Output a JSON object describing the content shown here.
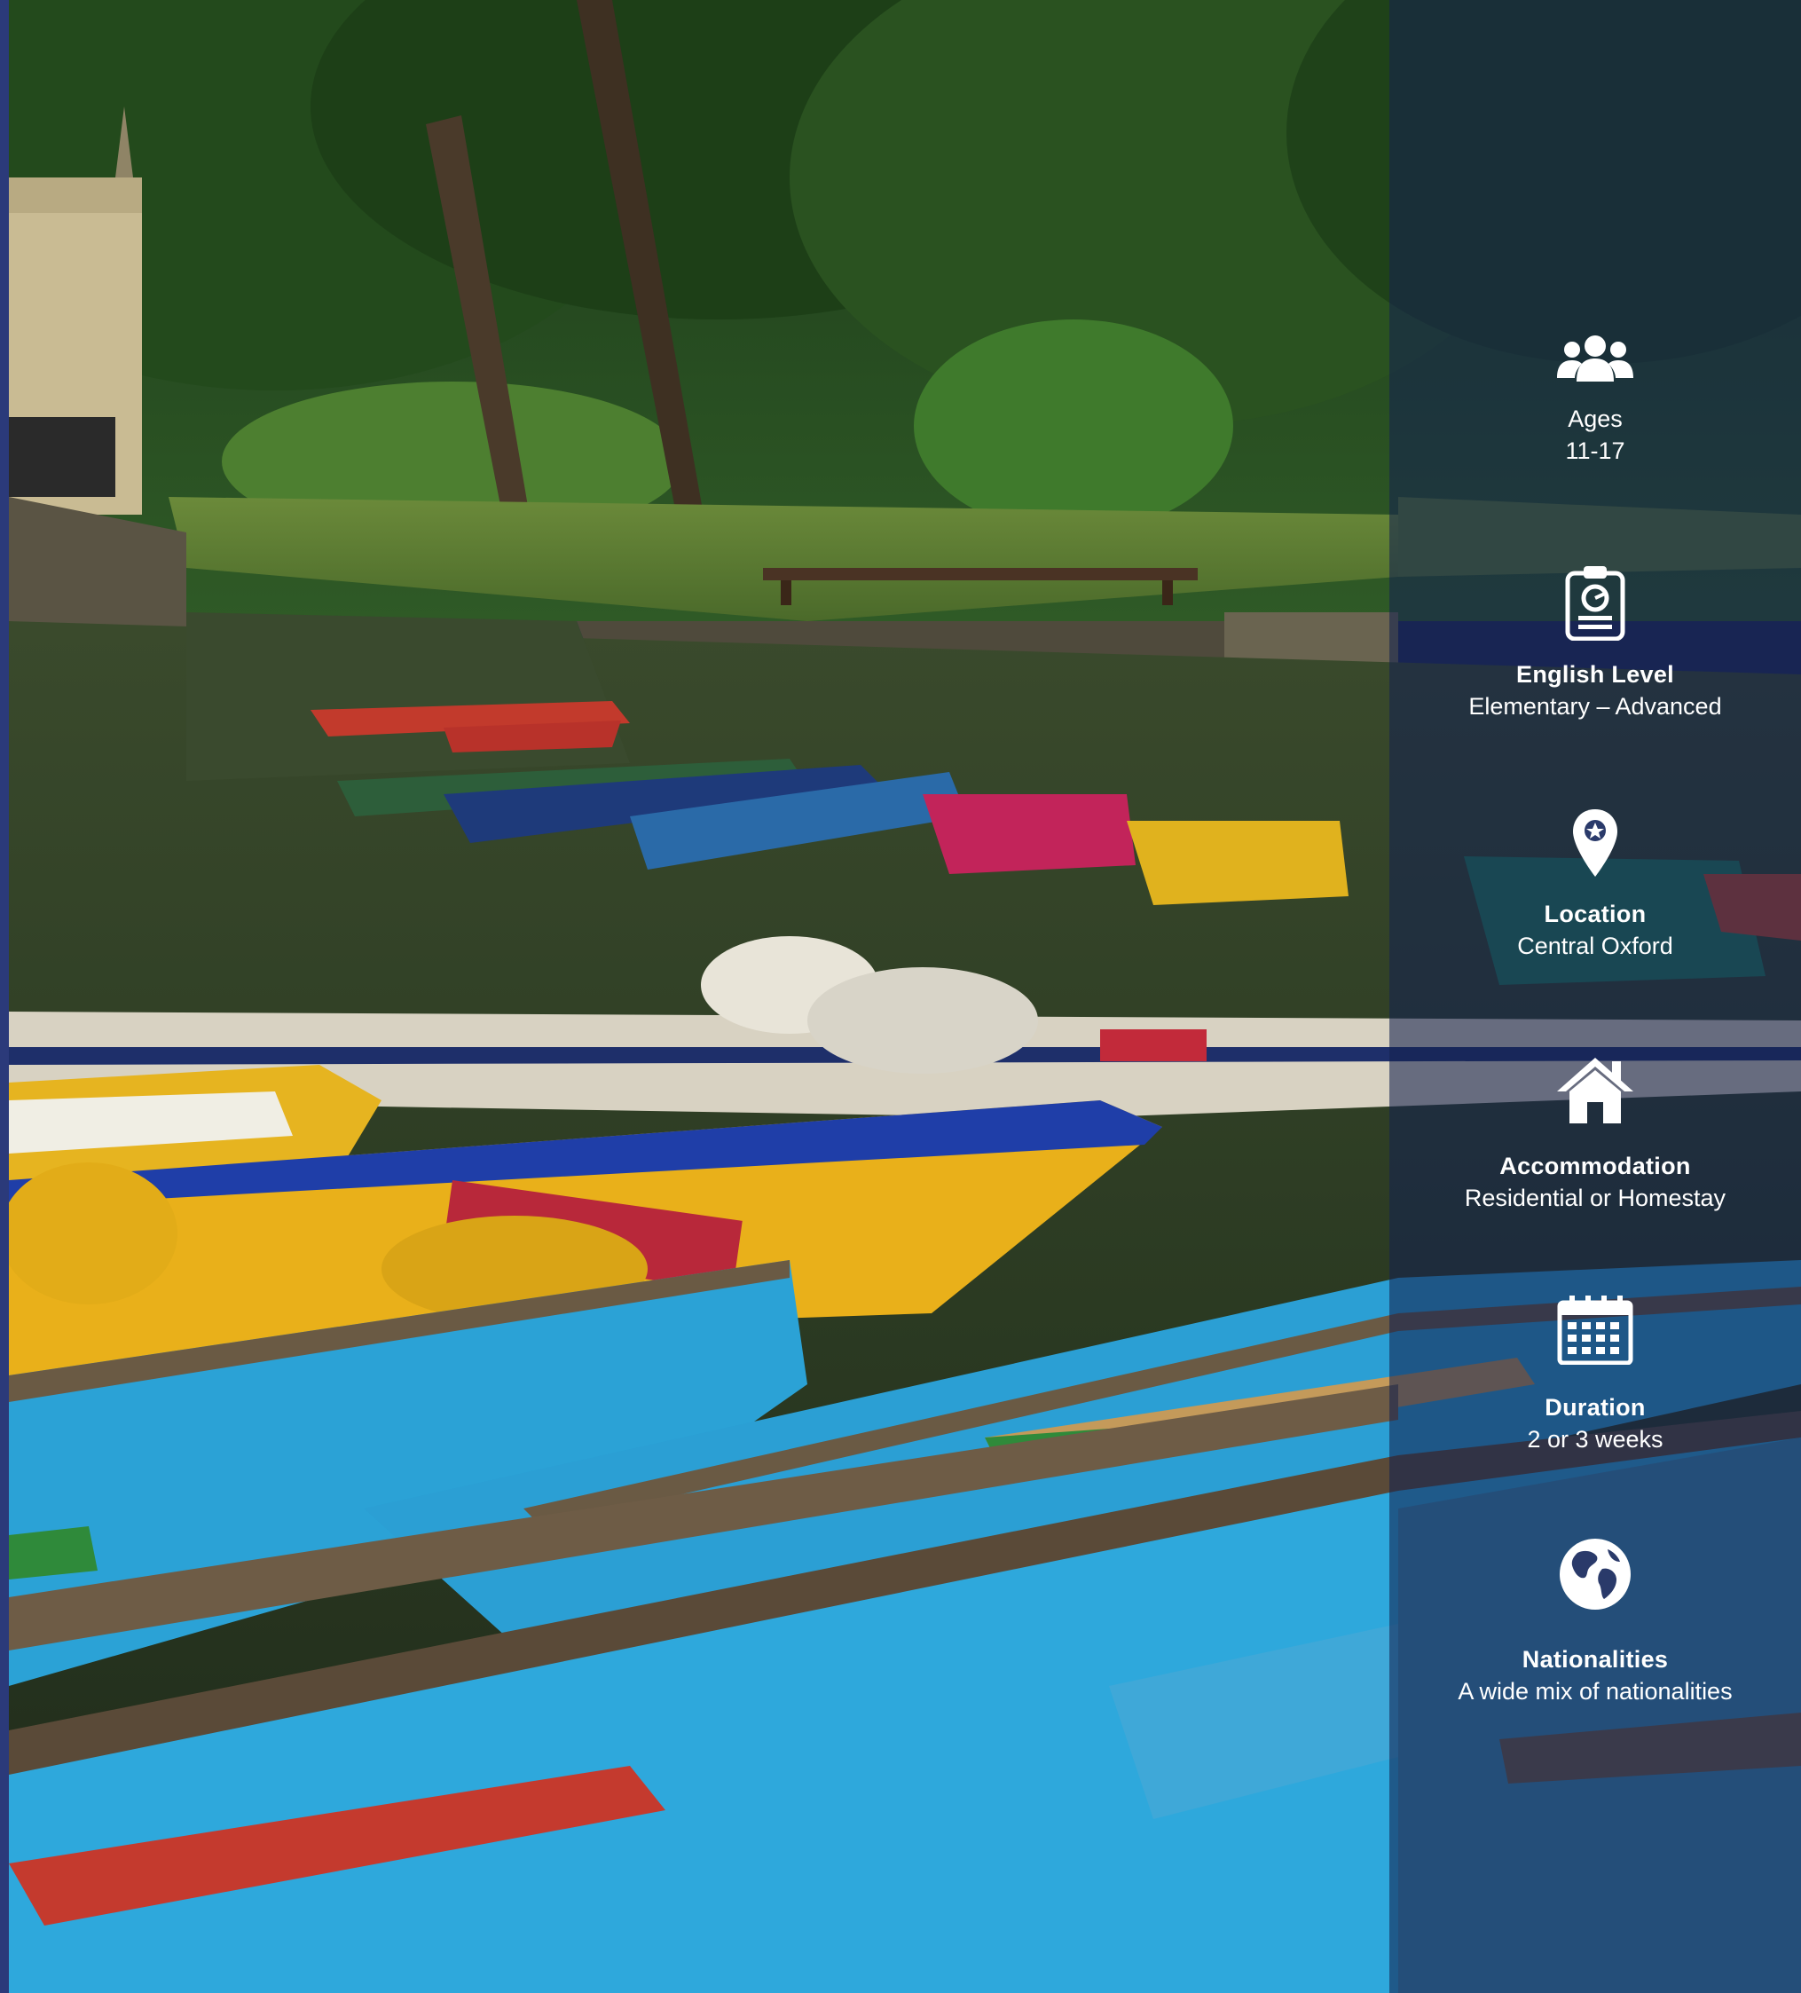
{
  "features": {
    "ages": {
      "title": "Ages",
      "value": "11-17"
    },
    "english_level": {
      "title": "English Level",
      "value": "Elementary – Advanced"
    },
    "location": {
      "title": "Location",
      "value": "Central Oxford"
    },
    "accommodation": {
      "title": "Accommodation",
      "value": "Residential or Homestay"
    },
    "duration": {
      "title": "Duration",
      "value": "2 or 3 weeks"
    },
    "nationalities": {
      "title": "Nationalities",
      "value": "A wide mix of nationalities"
    }
  },
  "icons": [
    "group-icon",
    "clipboard-icon",
    "location-pin-icon",
    "house-icon",
    "calendar-icon",
    "globe-icon"
  ],
  "colors": {
    "panel": "#142250",
    "left_bar": "#2b3a7a",
    "text": "#ffffff"
  }
}
